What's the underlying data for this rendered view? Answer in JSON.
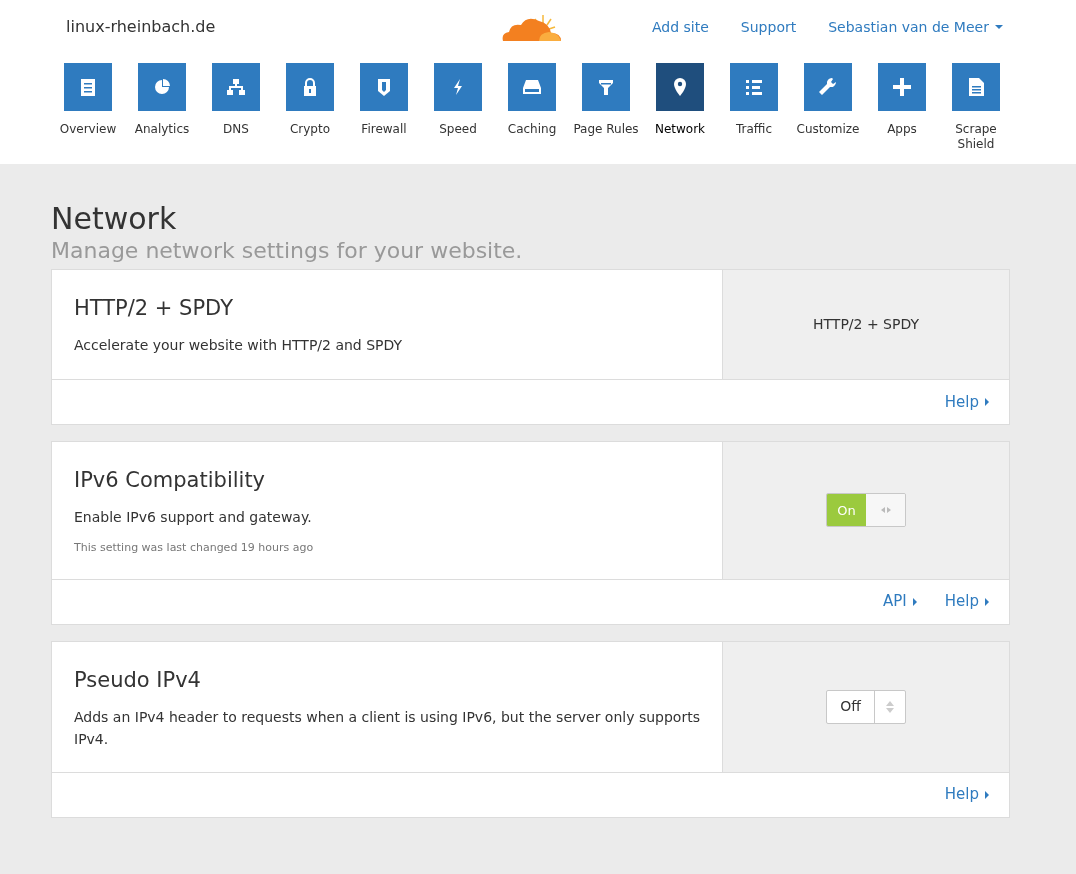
{
  "header": {
    "site": "linux-rheinbach.de",
    "links": [
      "Add site",
      "Support"
    ],
    "user": "Sebastian van de Meer"
  },
  "nav": [
    {
      "label": "Overview",
      "selected": false
    },
    {
      "label": "Analytics",
      "selected": false
    },
    {
      "label": "DNS",
      "selected": false
    },
    {
      "label": "Crypto",
      "selected": false
    },
    {
      "label": "Firewall",
      "selected": false
    },
    {
      "label": "Speed",
      "selected": false
    },
    {
      "label": "Caching",
      "selected": false
    },
    {
      "label": "Page Rules",
      "selected": false
    },
    {
      "label": "Network",
      "selected": true
    },
    {
      "label": "Traffic",
      "selected": false
    },
    {
      "label": "Customize",
      "selected": false
    },
    {
      "label": "Apps",
      "selected": false
    },
    {
      "label": "Scrape Shield",
      "selected": false
    }
  ],
  "page": {
    "title": "Network",
    "subtitle": "Manage network settings for your website."
  },
  "cards": [
    {
      "title": "HTTP/2 + SPDY",
      "description": "Accelerate your website with HTTP/2 and SPDY",
      "kind": "static",
      "value": "HTTP/2 + SPDY",
      "links": [
        "Help"
      ]
    },
    {
      "title": "IPv6 Compatibility",
      "description": "Enable IPv6 support and gateway.",
      "note": "This setting was last changed 19 hours ago",
      "kind": "toggle",
      "on": true,
      "value": "On",
      "links": [
        "API",
        "Help"
      ]
    },
    {
      "title": "Pseudo IPv4",
      "description": "Adds an IPv4 header to requests when a client is using IPv6, but the server only supports IPv4.",
      "kind": "select",
      "value": "Off",
      "links": [
        "Help"
      ]
    }
  ]
}
